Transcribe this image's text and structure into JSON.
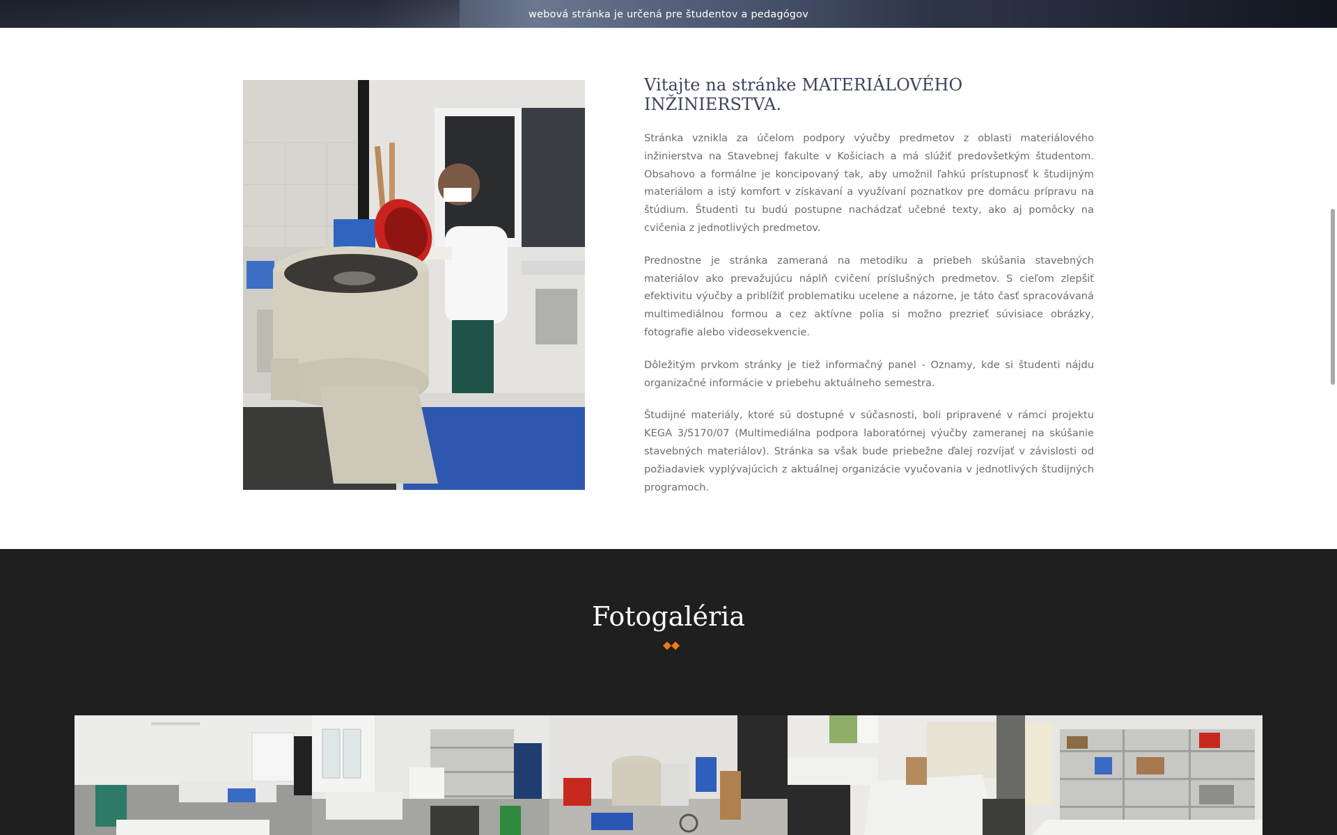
{
  "hero": {
    "subtitle": "webová stránka je určená pre študentov a pedagógov"
  },
  "welcome": {
    "title": "Vitajte na stránke MATERIÁLOVÉHO INŽINIERSTVA.",
    "paragraphs": [
      "Stránka vznikla za účelom podpory výučby predmetov z oblasti materiálového inžinierstva na Stavebnej fakulte v Košiciach a má slúžiť predovšetkým študentom. Obsahovo a formálne je koncipovaný tak, aby umožnil ľahkú prístupnosť k študijným materiálom a istý komfort v získavaní a využívaní poznatkov pre domácu prípravu na štúdium. Študenti tu budú postupne nachádzať učebné texty, ako aj pomôcky na cvičenia z jednotlivých predmetov.",
      "Prednostne je stránka zameraná na metodiku a priebeh skúšania stavebných materiálov ako prevažujúcu náplň cvičení príslušných predmetov. S cieľom zlepšiť efektivitu výučby a priblížiť problematiku ucelene a názorne, je táto časť spracovávaná multimediálnou formou a cez aktívne polia si možno prezrieť súvisiace obrázky, fotografie alebo videosekvencie.",
      "Dôležitým prvkom stránky je tiež informačný panel - Oznamy, kde si študenti nájdu organizačné informácie v priebehu aktuálneho semestra.",
      "Študijné materiály, ktoré sú dostupné v súčasnosti, boli pripravené v rámci projektu KEGA 3/5170/07 (Multimediálna podpora laboratórnej výučby zameranej na skúšanie stavebných materiálov). Stránka sa však bude priebežne ďalej rozvíjať v závislosti od požiadaviek vyplývajúcich z aktuálnej organizácie vyučovania v jednotlivých študijných programoch."
    ]
  },
  "gallery": {
    "title": "Fotogaléria",
    "accent_color": "#f07a14"
  },
  "colors": {
    "title_navy": "#3b4360",
    "body_text": "#6d6d6d",
    "gallery_bg": "#1f1f1f"
  }
}
